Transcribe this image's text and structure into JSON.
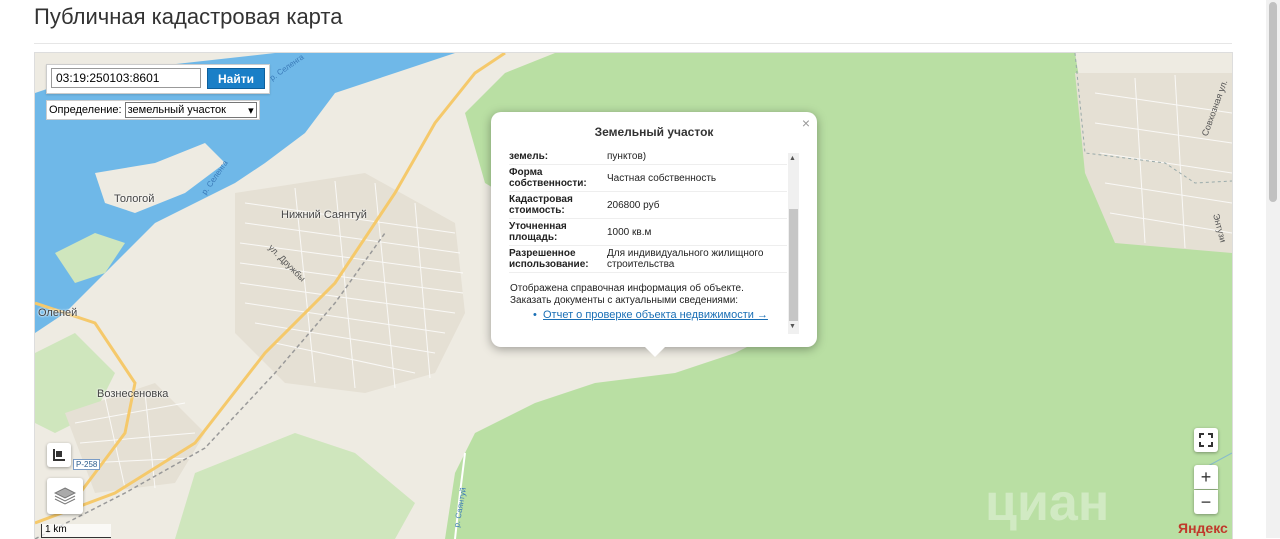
{
  "page": {
    "title": "Публичная кадастровая карта"
  },
  "search": {
    "value": "03:19:250103:8601",
    "button_label": "Найти"
  },
  "definition": {
    "label": "Определение:",
    "selected": "земельный участок"
  },
  "popup": {
    "title": "Земельный участок",
    "close": "×",
    "rows": [
      {
        "key": "земель:",
        "value": "пунктов)"
      },
      {
        "key": "Форма собственности:",
        "value": "Частная собственность"
      },
      {
        "key": "Кадастровая стоимость:",
        "value": "206800 руб"
      },
      {
        "key": "Уточненная площадь:",
        "value": "1000 кв.м"
      },
      {
        "key": "Разрешенное использование:",
        "value": "Для индивидуального жилищного строительства"
      }
    ],
    "note_line1": "Отображена справочная информация об объекте.",
    "note_line2": "Заказать документы с актуальными сведениями:",
    "link": "Отчет о проверке объекта недвижимости →"
  },
  "map": {
    "places": [
      "Тологой",
      "Нижний Саянтуй",
      "Вознесеновка",
      "Оленей"
    ],
    "roads": [
      "р. Селенга",
      "р. Селенга",
      "р. Саянтуй"
    ],
    "streets": [
      "ул. Дружбы",
      "Совхозная ул.",
      "Энтузи"
    ],
    "route": "Р-258",
    "scale": "1 km",
    "brand": "Яндекс",
    "watermark": "циан"
  },
  "colors": {
    "water": "#6fb8e8",
    "forest": "#b9dfa3",
    "land": "#eeebe2",
    "accent": "#1a7fc7"
  }
}
